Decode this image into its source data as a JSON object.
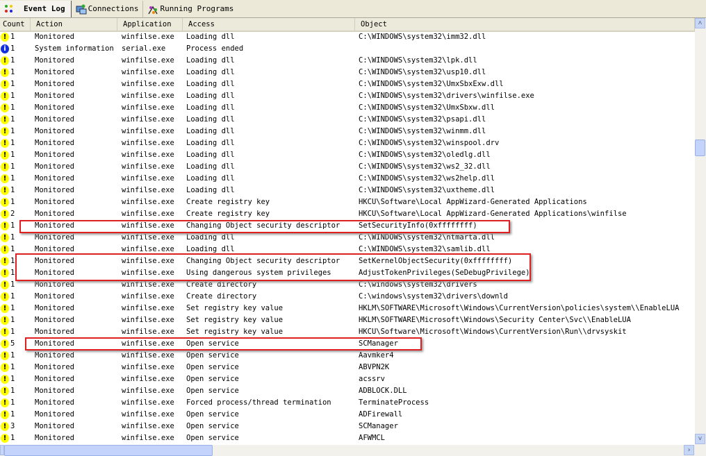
{
  "tabs": [
    {
      "label": "Event Log",
      "icon": "event-log-icon"
    },
    {
      "label": "Connections",
      "icon": "connections-icon"
    },
    {
      "label": "Running Programs",
      "icon": "running-programs-icon"
    }
  ],
  "columns": [
    "Count",
    "Action",
    "Application",
    "Access",
    "Object"
  ],
  "colors": {
    "highlight": "#e02020",
    "warning": "#ffff00",
    "info": "#1030e0"
  },
  "rows": [
    {
      "type": "warning",
      "count": "1",
      "action": "Monitored",
      "application": "winfilse.exe",
      "access": "Loading dll",
      "object": "C:\\WINDOWS\\system32\\imm32.dll"
    },
    {
      "type": "info",
      "count": "1",
      "action": "System information",
      "application": "serial.exe",
      "access": "Process ended",
      "object": ""
    },
    {
      "type": "warning",
      "count": "1",
      "action": "Monitored",
      "application": "winfilse.exe",
      "access": "Loading dll",
      "object": "C:\\WINDOWS\\system32\\lpk.dll"
    },
    {
      "type": "warning",
      "count": "1",
      "action": "Monitored",
      "application": "winfilse.exe",
      "access": "Loading dll",
      "object": "C:\\WINDOWS\\system32\\usp10.dll"
    },
    {
      "type": "warning",
      "count": "1",
      "action": "Monitored",
      "application": "winfilse.exe",
      "access": "Loading dll",
      "object": "C:\\WINDOWS\\system32\\UmxSbxExw.dll"
    },
    {
      "type": "warning",
      "count": "1",
      "action": "Monitored",
      "application": "winfilse.exe",
      "access": "Loading dll",
      "object": "C:\\WINDOWS\\system32\\drivers\\winfilse.exe"
    },
    {
      "type": "warning",
      "count": "1",
      "action": "Monitored",
      "application": "winfilse.exe",
      "access": "Loading dll",
      "object": "C:\\WINDOWS\\system32\\UmxSbxw.dll"
    },
    {
      "type": "warning",
      "count": "1",
      "action": "Monitored",
      "application": "winfilse.exe",
      "access": "Loading dll",
      "object": "C:\\WINDOWS\\system32\\psapi.dll"
    },
    {
      "type": "warning",
      "count": "1",
      "action": "Monitored",
      "application": "winfilse.exe",
      "access": "Loading dll",
      "object": "C:\\WINDOWS\\system32\\winmm.dll"
    },
    {
      "type": "warning",
      "count": "1",
      "action": "Monitored",
      "application": "winfilse.exe",
      "access": "Loading dll",
      "object": "C:\\WINDOWS\\system32\\winspool.drv"
    },
    {
      "type": "warning",
      "count": "1",
      "action": "Monitored",
      "application": "winfilse.exe",
      "access": "Loading dll",
      "object": "C:\\WINDOWS\\system32\\oledlg.dll"
    },
    {
      "type": "warning",
      "count": "1",
      "action": "Monitored",
      "application": "winfilse.exe",
      "access": "Loading dll",
      "object": "C:\\WINDOWS\\system32\\ws2_32.dll"
    },
    {
      "type": "warning",
      "count": "1",
      "action": "Monitored",
      "application": "winfilse.exe",
      "access": "Loading dll",
      "object": "C:\\WINDOWS\\system32\\ws2help.dll"
    },
    {
      "type": "warning",
      "count": "1",
      "action": "Monitored",
      "application": "winfilse.exe",
      "access": "Loading dll",
      "object": "C:\\WINDOWS\\system32\\uxtheme.dll"
    },
    {
      "type": "warning",
      "count": "1",
      "action": "Monitored",
      "application": "winfilse.exe",
      "access": "Create registry key",
      "object": "HKCU\\Software\\Local AppWizard-Generated Applications"
    },
    {
      "type": "warning",
      "count": "2",
      "action": "Monitored",
      "application": "winfilse.exe",
      "access": "Create registry key",
      "object": "HKCU\\Software\\Local AppWizard-Generated Applications\\winfilse"
    },
    {
      "type": "warning",
      "count": "1",
      "action": "Monitored",
      "application": "winfilse.exe",
      "access": "Changing Object security descriptor",
      "object": "SetSecurityInfo(0xffffffff)"
    },
    {
      "type": "warning",
      "count": "1",
      "action": "Monitored",
      "application": "winfilse.exe",
      "access": "Loading dll",
      "object": "C:\\WINDOWS\\system32\\ntmarta.dll"
    },
    {
      "type": "warning",
      "count": "1",
      "action": "Monitored",
      "application": "winfilse.exe",
      "access": "Loading dll",
      "object": "C:\\WINDOWS\\system32\\samlib.dll"
    },
    {
      "type": "warning",
      "count": "1",
      "action": "Monitored",
      "application": "winfilse.exe",
      "access": "Changing Object security descriptor",
      "object": "SetKernelObjectSecurity(0xffffffff)"
    },
    {
      "type": "warning",
      "count": "1",
      "action": "Monitored",
      "application": "winfilse.exe",
      "access": "Using dangerous system privileges",
      "object": "AdjustTokenPrivileges(SeDebugPrivilege)"
    },
    {
      "type": "warning",
      "count": "1",
      "action": "Monitored",
      "application": "winfilse.exe",
      "access": "Create directory",
      "object": "C:\\windows\\system32\\drivers"
    },
    {
      "type": "warning",
      "count": "1",
      "action": "Monitored",
      "application": "winfilse.exe",
      "access": "Create directory",
      "object": "C:\\windows\\system32\\drivers\\downld"
    },
    {
      "type": "warning",
      "count": "1",
      "action": "Monitored",
      "application": "winfilse.exe",
      "access": "Set registry key value",
      "object": "HKLM\\SOFTWARE\\Microsoft\\Windows\\CurrentVersion\\policies\\system\\\\EnableLUA"
    },
    {
      "type": "warning",
      "count": "1",
      "action": "Monitored",
      "application": "winfilse.exe",
      "access": "Set registry key value",
      "object": "HKLM\\SOFTWARE\\Microsoft\\Windows\\Security Center\\Svc\\\\EnableLUA"
    },
    {
      "type": "warning",
      "count": "1",
      "action": "Monitored",
      "application": "winfilse.exe",
      "access": "Set registry key value",
      "object": "HKCU\\Software\\Microsoft\\Windows\\CurrentVersion\\Run\\\\drvsyskit"
    },
    {
      "type": "warning",
      "count": "5",
      "action": "Monitored",
      "application": "winfilse.exe",
      "access": "Open service",
      "object": "SCManager"
    },
    {
      "type": "warning",
      "count": "1",
      "action": "Monitored",
      "application": "winfilse.exe",
      "access": "Open service",
      "object": "Aavmker4"
    },
    {
      "type": "warning",
      "count": "1",
      "action": "Monitored",
      "application": "winfilse.exe",
      "access": "Open service",
      "object": "ABVPN2K"
    },
    {
      "type": "warning",
      "count": "1",
      "action": "Monitored",
      "application": "winfilse.exe",
      "access": "Open service",
      "object": "acssrv"
    },
    {
      "type": "warning",
      "count": "1",
      "action": "Monitored",
      "application": "winfilse.exe",
      "access": "Open service",
      "object": "ADBLOCK.DLL"
    },
    {
      "type": "warning",
      "count": "1",
      "action": "Monitored",
      "application": "winfilse.exe",
      "access": "Forced process/thread termination",
      "object": "TerminateProcess"
    },
    {
      "type": "warning",
      "count": "1",
      "action": "Monitored",
      "application": "winfilse.exe",
      "access": "Open service",
      "object": "ADFirewall"
    },
    {
      "type": "warning",
      "count": "3",
      "action": "Monitored",
      "application": "winfilse.exe",
      "access": "Open service",
      "object": "SCManager"
    },
    {
      "type": "warning",
      "count": "1",
      "action": "Monitored",
      "application": "winfilse.exe",
      "access": "Open service",
      "object": "AFWMCL"
    }
  ]
}
